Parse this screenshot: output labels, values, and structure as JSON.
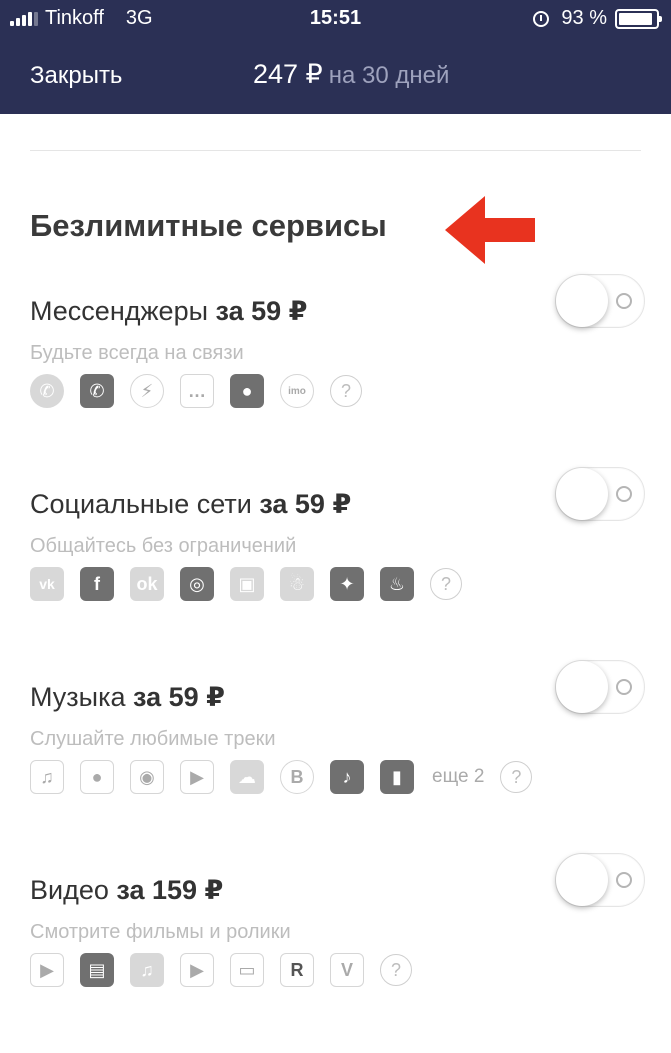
{
  "status_bar": {
    "carrier": "Tinkoff",
    "network": "3G",
    "time": "15:51",
    "battery": "93 %"
  },
  "header": {
    "close_label": "Закрыть",
    "price": "247 ₽",
    "period": "на 30 дней",
    "background": "#2b3055"
  },
  "section": {
    "title": "Безлимитные сервисы",
    "arrow_color": "#e8331f"
  },
  "services": [
    {
      "name": "Мессенджеры",
      "price": "за 59 ₽",
      "subtitle": "Будьте всегда на связи",
      "toggle_on": false,
      "icons": [
        "whatsapp-icon",
        "viber-icon",
        "messenger-icon",
        "imessage-icon",
        "chat-bubble-icon",
        "imo-icon"
      ]
    },
    {
      "name": "Социальные сети",
      "price": "за 59 ₽",
      "subtitle": "Общайтесь без ограничений",
      "toggle_on": false,
      "icons": [
        "vk-icon",
        "facebook-icon",
        "odnoklassniki-icon",
        "instagram-icon",
        "igtv-icon",
        "snapchat-icon",
        "twitter-icon",
        "tinder-icon"
      ]
    },
    {
      "name": "Музыка",
      "price": "за 59 ₽",
      "subtitle": "Слушайте любимые треки",
      "toggle_on": false,
      "more": "еще 2",
      "icons": [
        "apple-music-icon",
        "music-disc-icon",
        "podcast-icon",
        "google-play-music-icon",
        "soundcloud-icon",
        "boom-icon",
        "music-note-icon",
        "equalizer-icon"
      ]
    },
    {
      "name": "Видео",
      "price": "за 159 ₽",
      "subtitle": "Смотрите фильмы и ролики",
      "toggle_on": false,
      "icons": [
        "youtube-icon",
        "twitch-icon",
        "itunes-icon",
        "google-play-movies-icon",
        "youtube-tv-icon",
        "rutube-icon",
        "vimeo-icon"
      ]
    }
  ],
  "help_glyph": "?"
}
